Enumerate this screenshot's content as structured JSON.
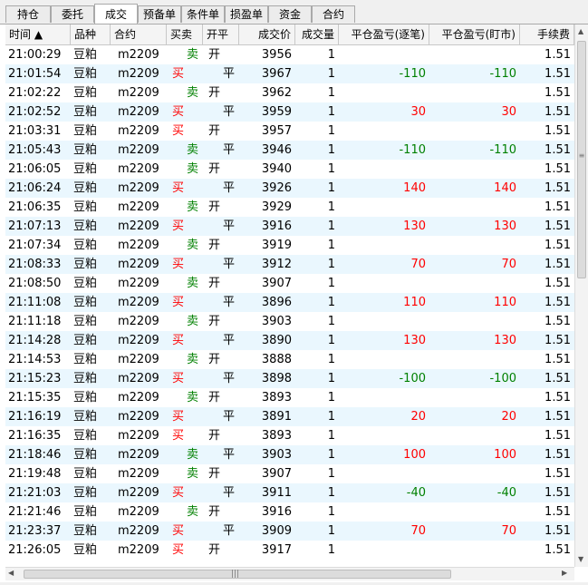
{
  "tabs": [
    {
      "label": "持仓"
    },
    {
      "label": "委托"
    },
    {
      "label": "成交",
      "active": true
    },
    {
      "label": "预备单"
    },
    {
      "label": "条件单"
    },
    {
      "label": "损盈单"
    },
    {
      "label": "资金"
    },
    {
      "label": "合约"
    }
  ],
  "columns": [
    "时间 ▲",
    "品种",
    "合约",
    "买卖",
    "开平",
    "成交价",
    "成交量",
    "平仓盈亏(逐笔)",
    "平仓盈亏(盯市)",
    "手续费"
  ],
  "colors": {
    "buy": "#ff0000",
    "sell": "#008000",
    "alt_row": "#eaf7fe"
  },
  "rows": [
    {
      "time": "21:00:29",
      "product": "豆粕",
      "contract": "m2209",
      "side": "卖",
      "oc": "开",
      "price": "3956",
      "qty": "1",
      "pnl_trade": "",
      "pnl_mtm": "",
      "fee": "1.51"
    },
    {
      "time": "21:01:54",
      "product": "豆粕",
      "contract": "m2209",
      "side": "买",
      "oc": "平",
      "price": "3967",
      "qty": "1",
      "pnl_trade": "-110",
      "pnl_mtm": "-110",
      "fee": "1.51"
    },
    {
      "time": "21:02:22",
      "product": "豆粕",
      "contract": "m2209",
      "side": "卖",
      "oc": "开",
      "price": "3962",
      "qty": "1",
      "pnl_trade": "",
      "pnl_mtm": "",
      "fee": "1.51"
    },
    {
      "time": "21:02:52",
      "product": "豆粕",
      "contract": "m2209",
      "side": "买",
      "oc": "平",
      "price": "3959",
      "qty": "1",
      "pnl_trade": "30",
      "pnl_mtm": "30",
      "fee": "1.51"
    },
    {
      "time": "21:03:31",
      "product": "豆粕",
      "contract": "m2209",
      "side": "买",
      "oc": "开",
      "price": "3957",
      "qty": "1",
      "pnl_trade": "",
      "pnl_mtm": "",
      "fee": "1.51"
    },
    {
      "time": "21:05:43",
      "product": "豆粕",
      "contract": "m2209",
      "side": "卖",
      "oc": "平",
      "price": "3946",
      "qty": "1",
      "pnl_trade": "-110",
      "pnl_mtm": "-110",
      "fee": "1.51"
    },
    {
      "time": "21:06:05",
      "product": "豆粕",
      "contract": "m2209",
      "side": "卖",
      "oc": "开",
      "price": "3940",
      "qty": "1",
      "pnl_trade": "",
      "pnl_mtm": "",
      "fee": "1.51"
    },
    {
      "time": "21:06:24",
      "product": "豆粕",
      "contract": "m2209",
      "side": "买",
      "oc": "平",
      "price": "3926",
      "qty": "1",
      "pnl_trade": "140",
      "pnl_mtm": "140",
      "fee": "1.51"
    },
    {
      "time": "21:06:35",
      "product": "豆粕",
      "contract": "m2209",
      "side": "卖",
      "oc": "开",
      "price": "3929",
      "qty": "1",
      "pnl_trade": "",
      "pnl_mtm": "",
      "fee": "1.51"
    },
    {
      "time": "21:07:13",
      "product": "豆粕",
      "contract": "m2209",
      "side": "买",
      "oc": "平",
      "price": "3916",
      "qty": "1",
      "pnl_trade": "130",
      "pnl_mtm": "130",
      "fee": "1.51"
    },
    {
      "time": "21:07:34",
      "product": "豆粕",
      "contract": "m2209",
      "side": "卖",
      "oc": "开",
      "price": "3919",
      "qty": "1",
      "pnl_trade": "",
      "pnl_mtm": "",
      "fee": "1.51"
    },
    {
      "time": "21:08:33",
      "product": "豆粕",
      "contract": "m2209",
      "side": "买",
      "oc": "平",
      "price": "3912",
      "qty": "1",
      "pnl_trade": "70",
      "pnl_mtm": "70",
      "fee": "1.51"
    },
    {
      "time": "21:08:50",
      "product": "豆粕",
      "contract": "m2209",
      "side": "卖",
      "oc": "开",
      "price": "3907",
      "qty": "1",
      "pnl_trade": "",
      "pnl_mtm": "",
      "fee": "1.51"
    },
    {
      "time": "21:11:08",
      "product": "豆粕",
      "contract": "m2209",
      "side": "买",
      "oc": "平",
      "price": "3896",
      "qty": "1",
      "pnl_trade": "110",
      "pnl_mtm": "110",
      "fee": "1.51"
    },
    {
      "time": "21:11:18",
      "product": "豆粕",
      "contract": "m2209",
      "side": "卖",
      "oc": "开",
      "price": "3903",
      "qty": "1",
      "pnl_trade": "",
      "pnl_mtm": "",
      "fee": "1.51"
    },
    {
      "time": "21:14:28",
      "product": "豆粕",
      "contract": "m2209",
      "side": "买",
      "oc": "平",
      "price": "3890",
      "qty": "1",
      "pnl_trade": "130",
      "pnl_mtm": "130",
      "fee": "1.51"
    },
    {
      "time": "21:14:53",
      "product": "豆粕",
      "contract": "m2209",
      "side": "卖",
      "oc": "开",
      "price": "3888",
      "qty": "1",
      "pnl_trade": "",
      "pnl_mtm": "",
      "fee": "1.51"
    },
    {
      "time": "21:15:23",
      "product": "豆粕",
      "contract": "m2209",
      "side": "买",
      "oc": "平",
      "price": "3898",
      "qty": "1",
      "pnl_trade": "-100",
      "pnl_mtm": "-100",
      "fee": "1.51"
    },
    {
      "time": "21:15:35",
      "product": "豆粕",
      "contract": "m2209",
      "side": "卖",
      "oc": "开",
      "price": "3893",
      "qty": "1",
      "pnl_trade": "",
      "pnl_mtm": "",
      "fee": "1.51"
    },
    {
      "time": "21:16:19",
      "product": "豆粕",
      "contract": "m2209",
      "side": "买",
      "oc": "平",
      "price": "3891",
      "qty": "1",
      "pnl_trade": "20",
      "pnl_mtm": "20",
      "fee": "1.51"
    },
    {
      "time": "21:16:35",
      "product": "豆粕",
      "contract": "m2209",
      "side": "买",
      "oc": "开",
      "price": "3893",
      "qty": "1",
      "pnl_trade": "",
      "pnl_mtm": "",
      "fee": "1.51"
    },
    {
      "time": "21:18:46",
      "product": "豆粕",
      "contract": "m2209",
      "side": "卖",
      "oc": "平",
      "price": "3903",
      "qty": "1",
      "pnl_trade": "100",
      "pnl_mtm": "100",
      "fee": "1.51"
    },
    {
      "time": "21:19:48",
      "product": "豆粕",
      "contract": "m2209",
      "side": "卖",
      "oc": "开",
      "price": "3907",
      "qty": "1",
      "pnl_trade": "",
      "pnl_mtm": "",
      "fee": "1.51"
    },
    {
      "time": "21:21:03",
      "product": "豆粕",
      "contract": "m2209",
      "side": "买",
      "oc": "平",
      "price": "3911",
      "qty": "1",
      "pnl_trade": "-40",
      "pnl_mtm": "-40",
      "fee": "1.51"
    },
    {
      "time": "21:21:46",
      "product": "豆粕",
      "contract": "m2209",
      "side": "卖",
      "oc": "开",
      "price": "3916",
      "qty": "1",
      "pnl_trade": "",
      "pnl_mtm": "",
      "fee": "1.51"
    },
    {
      "time": "21:23:37",
      "product": "豆粕",
      "contract": "m2209",
      "side": "买",
      "oc": "平",
      "price": "3909",
      "qty": "1",
      "pnl_trade": "70",
      "pnl_mtm": "70",
      "fee": "1.51"
    },
    {
      "time": "21:26:05",
      "product": "豆粕",
      "contract": "m2209",
      "side": "买",
      "oc": "开",
      "price": "3917",
      "qty": "1",
      "pnl_trade": "",
      "pnl_mtm": "",
      "fee": "1.51"
    }
  ]
}
